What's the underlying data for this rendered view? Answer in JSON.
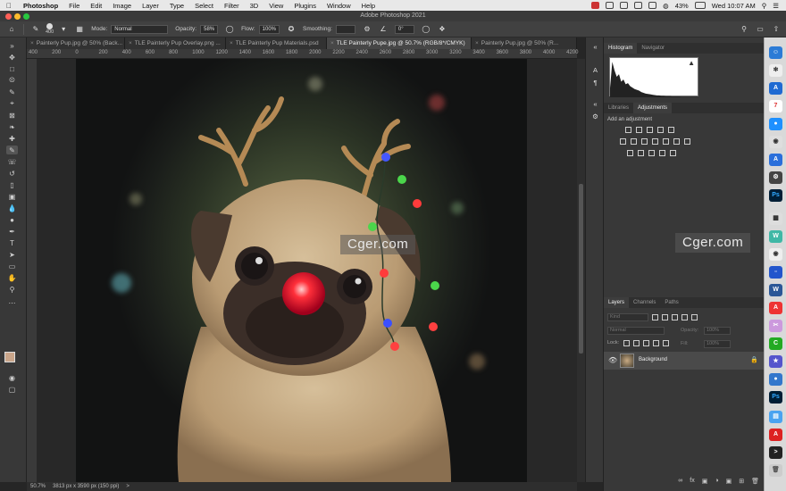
{
  "menubar": {
    "app": "Photoshop",
    "items": [
      "File",
      "Edit",
      "Image",
      "Layer",
      "Type",
      "Select",
      "Filter",
      "3D",
      "View",
      "Plugins",
      "Window",
      "Help"
    ],
    "battery": "43%",
    "clock": "Wed 10:07 AM"
  },
  "window": {
    "title": "Adobe Photoshop 2021"
  },
  "options": {
    "brush_size": "400",
    "mode_label": "Mode:",
    "mode_value": "Normal",
    "opacity_label": "Opacity:",
    "opacity_value": "58%",
    "flow_label": "Flow:",
    "flow_value": "100%",
    "smoothing_label": "Smoothing:",
    "angle_value": "0°"
  },
  "tabs": [
    {
      "label": "Painterly Pup.jpg @ 50% (Back..."
    },
    {
      "label": "TLE Painterly Pup Overlay.png ..."
    },
    {
      "label": "TLE Painterly Pup Materials.psd"
    },
    {
      "label": "TLE Painterly Pupe.jpg @ 50.7% (RGB/8*/CMYK)"
    },
    {
      "label": "Painterly Pup.jpg @ 50% (R..."
    }
  ],
  "ruler": {
    "ticks": [
      "400",
      "200",
      "0",
      "200",
      "400",
      "600",
      "800",
      "1000",
      "1200",
      "1400",
      "1600",
      "1800",
      "2000",
      "2200",
      "2400",
      "2600",
      "2800",
      "3000",
      "3200",
      "3400",
      "3600",
      "3800",
      "4000",
      "4200"
    ]
  },
  "status": {
    "zoom": "50.7%",
    "doc_info": "3813 px x 3590 px (150 ppi)",
    "arrow": ">"
  },
  "panels": {
    "histogram_tabs": [
      "Histogram",
      "Navigator"
    ],
    "adjust_tabs": [
      "Libraries",
      "Adjustments"
    ],
    "adjust_hint": "Add an adjustment",
    "layers_tabs": [
      "Layers",
      "Channels",
      "Paths"
    ],
    "kind_placeholder": "Kind",
    "blend_mode": "Normal",
    "opacity_label": "Opacity:",
    "opacity_value": "100%",
    "lock_label": "Lock:",
    "fill_label": "Fill:",
    "fill_value": "100%",
    "layer_name": "Background"
  },
  "histogram": {
    "values": [
      0.25,
      0.95,
      0.72,
      0.55,
      0.62,
      0.42,
      0.48,
      0.35,
      0.38,
      0.3,
      0.26,
      0.22,
      0.2,
      0.18,
      0.14,
      0.12,
      0.1,
      0.09,
      0.08,
      0.07,
      0.06,
      0.05,
      0.05,
      0.04,
      0.04,
      0.03,
      0.03,
      0.03,
      0.02,
      0.02,
      0.02,
      0.02,
      0.01,
      0.01,
      0.01,
      0.01,
      0.01,
      0.01,
      0.01,
      0.01
    ]
  },
  "watermark": "Cger.com",
  "dock_icons": [
    "safari-icon",
    "app-store-icon",
    "outlook-icon",
    "calendar-icon",
    "photoshop-icon",
    "finder-icon",
    "word-icon",
    "photoshop-icon",
    "trash-icon"
  ],
  "colors": {
    "accent": "#1473e6",
    "ps_blue": "#001e36",
    "ps_text": "#31a8ff"
  }
}
